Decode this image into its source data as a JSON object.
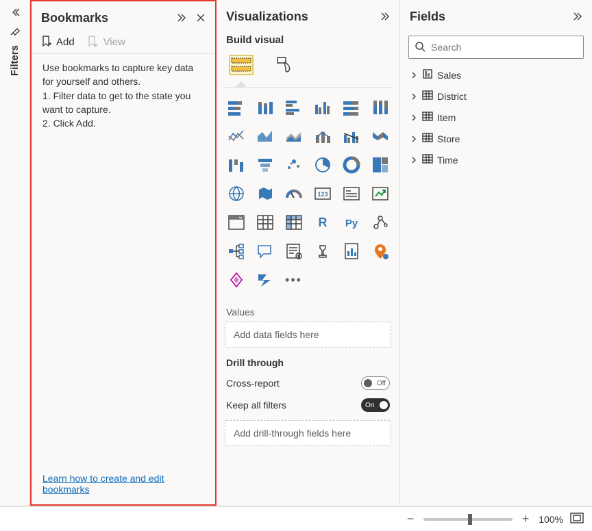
{
  "filters": {
    "label": "Filters"
  },
  "bookmarks": {
    "title": "Bookmarks",
    "add_label": "Add",
    "view_label": "View",
    "help_intro": "Use bookmarks to capture key data for yourself and others.",
    "help_step1": "1. Filter data to get to the state you want to capture.",
    "help_step2": "2. Click Add.",
    "learn_link": "Learn how to create and edit bookmarks"
  },
  "viz": {
    "title": "Visualizations",
    "build_label": "Build visual",
    "values_label": "Values",
    "values_placeholder": "Add data fields here",
    "drill_label": "Drill through",
    "cross_report_label": "Cross-report",
    "cross_report_state": "Off",
    "keep_filters_label": "Keep all filters",
    "keep_filters_state": "On",
    "drill_placeholder": "Add drill-through fields here"
  },
  "fields": {
    "title": "Fields",
    "search_placeholder": "Search",
    "tables": [
      {
        "name": "Sales",
        "icon": "measure"
      },
      {
        "name": "District",
        "icon": "table"
      },
      {
        "name": "Item",
        "icon": "table"
      },
      {
        "name": "Store",
        "icon": "table"
      },
      {
        "name": "Time",
        "icon": "table"
      }
    ]
  },
  "zoom": {
    "percent": "100%"
  }
}
